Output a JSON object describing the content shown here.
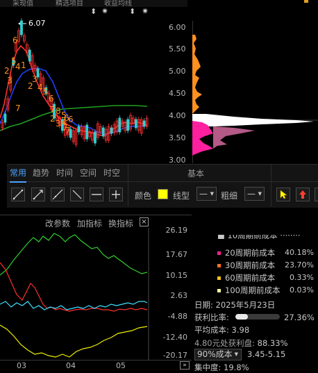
{
  "header": {
    "left_items": [
      "采现值",
      "精选项目",
      "收益均线"
    ]
  },
  "kline": {
    "high_marker_text": "6.07",
    "wave_numbers": [
      "6",
      "5",
      "2",
      "3",
      "4",
      "7",
      "1",
      "2",
      "3",
      "4",
      "5",
      "6",
      "7",
      "8",
      "2",
      "3",
      "4",
      "5",
      "6",
      "7",
      "6",
      "7"
    ],
    "colors": {
      "up": "#ff3030",
      "down": "#30d0d0",
      "ma_fast": "#ff3030",
      "ma_mid": "#2040ff",
      "ma_slow": "#20a020",
      "wave_text": "#ff9020"
    }
  },
  "price_axis": {
    "ticks": [
      "6.00",
      "5.50",
      "5.00",
      "4.50",
      "4.00",
      "3.50",
      "3.00"
    ]
  },
  "cost_distribution": {
    "colors": {
      "profit": "#ff9020",
      "loss": "#ffffff",
      "recent": "#ff20a0"
    }
  },
  "toolbar": {
    "tabs": [
      "常用",
      "趋势",
      "时间",
      "空间",
      "时空"
    ],
    "active_tab": "常用",
    "panel_title": "基本",
    "tools": [
      "line-segment-icon",
      "ray-icon",
      "extended-line-icon",
      "diagonal-line-icon",
      "horizontal-line-icon",
      "crosshair-plus-icon"
    ],
    "color_label": "颜色",
    "color_value": "#ffff00",
    "line_type_label": "线型",
    "line_type_value": "—",
    "line_width_label": "粗细",
    "line_width_value": "—",
    "right_tools": [
      "pointer-icon",
      "up-arrow-icon"
    ]
  },
  "indicator": {
    "links": [
      "改参数",
      "加指标",
      "换指标"
    ],
    "close_label": "×",
    "y_ticks": [
      "26.19",
      "17.67",
      "10.15",
      "2.63",
      "-4.88",
      "-12.40",
      "-20.17"
    ],
    "x_ticks": [
      "03",
      "04",
      "05"
    ],
    "colors": {
      "green": "#30d030",
      "red": "#ff3030",
      "cyan": "#40e0ff",
      "yellow": "#f0f000"
    }
  },
  "cost_panel": {
    "legend": [
      {
        "label": "20周期前成本",
        "value": "40.18%",
        "color": "#ff2090"
      },
      {
        "label": "30周期前成本",
        "value": "23.70%",
        "color": "#ff7020"
      },
      {
        "label": "60周期前成本",
        "value": "0.33%",
        "color": "#ffc020"
      },
      {
        "label": "100周期前成本",
        "value": "0.03%",
        "color": "#ffffa0"
      }
    ],
    "date_label": "日期: 2025年5月23日",
    "profit_ratio_label": "获利比率:",
    "profit_ratio_value": "27.36%",
    "profit_ratio_fraction": 0.2736,
    "avg_cost_label": "平均成本: 3.98",
    "profit_at_price_prefix": "4.80元处获利盘:",
    "profit_at_price_value": "88.33%",
    "cost_select_value": "90%成本",
    "cost_range": "3.45-5.15",
    "concentration_label": "集中度: 19.8%"
  }
}
